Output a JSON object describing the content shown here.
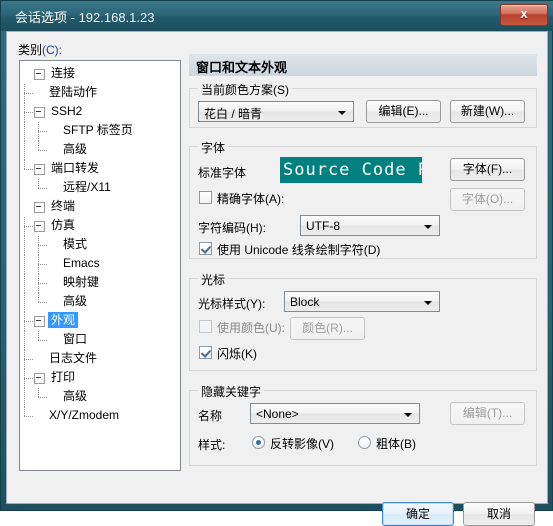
{
  "window": {
    "title_main": "会话选项",
    "title_sep": " - ",
    "title_host": "192.168.1.23",
    "close_icon": "close-icon",
    "close_glyph": "x"
  },
  "tree": {
    "label": "类别(C):",
    "label_text": "类别",
    "label_accel": "(C):",
    "selected": "外观",
    "nodes": [
      {
        "label": "连接",
        "depth": 0,
        "expandable": true,
        "selected": false
      },
      {
        "label": "登陆动作",
        "depth": 1,
        "expandable": false,
        "selected": false
      },
      {
        "label": "SSH2",
        "depth": 1,
        "expandable": true,
        "selected": false
      },
      {
        "label": "SFTP 标签页",
        "depth": 2,
        "expandable": false,
        "selected": false
      },
      {
        "label": "高级",
        "depth": 2,
        "expandable": false,
        "selected": false
      },
      {
        "label": "端口转发",
        "depth": 1,
        "expandable": true,
        "selected": false
      },
      {
        "label": "远程/X11",
        "depth": 2,
        "expandable": false,
        "selected": false
      },
      {
        "label": "终端",
        "depth": 0,
        "expandable": true,
        "selected": false
      },
      {
        "label": "仿真",
        "depth": 1,
        "expandable": true,
        "selected": false
      },
      {
        "label": "模式",
        "depth": 2,
        "expandable": false,
        "selected": false
      },
      {
        "label": "Emacs",
        "depth": 2,
        "expandable": false,
        "selected": false
      },
      {
        "label": "映射键",
        "depth": 2,
        "expandable": false,
        "selected": false
      },
      {
        "label": "高级",
        "depth": 2,
        "expandable": false,
        "selected": false
      },
      {
        "label": "外观",
        "depth": 1,
        "expandable": true,
        "selected": true
      },
      {
        "label": "窗口",
        "depth": 2,
        "expandable": false,
        "selected": false
      },
      {
        "label": "日志文件",
        "depth": 1,
        "expandable": false,
        "selected": false
      },
      {
        "label": "打印",
        "depth": 1,
        "expandable": true,
        "selected": false
      },
      {
        "label": "高级",
        "depth": 2,
        "expandable": false,
        "selected": false
      },
      {
        "label": "X/Y/Zmodem",
        "depth": 1,
        "expandable": false,
        "selected": false
      }
    ]
  },
  "pane": {
    "header": "窗口和文本外观",
    "color_scheme": {
      "group_title": "当前颜色方案(S)",
      "value": "花白 / 暗青",
      "edit_button": "编辑(E)...",
      "new_button": "新建(W)..."
    },
    "font": {
      "group_title": "字体",
      "standard_label": "标准字体",
      "preview_text": "Source Code P",
      "preview_bg": "#00807f",
      "preview_fg": "#ffffff",
      "font_button": "字体(F)...",
      "exact_font_label": "精确字体(A):",
      "exact_font_checked": false,
      "exact_font_button": "字体(O)...",
      "encoding_label": "字符编码(H):",
      "encoding_value": "UTF-8",
      "unicode_line_label": "使用 Unicode 线条绘制字符(D)",
      "unicode_line_checked": true
    },
    "cursor": {
      "group_title": "光标",
      "style_label": "光标样式(Y):",
      "style_value": "Block",
      "use_color_label": "使用颜色(U):",
      "use_color_checked": false,
      "color_button": "颜色(R)...",
      "blink_label": "闪烁(K)",
      "blink_checked": true
    },
    "keyword": {
      "group_title": "隐藏关键字",
      "name_label": "名称",
      "name_value": "<None>",
      "edit_button": "编辑(T)...",
      "style_label": "样式:",
      "option_reverse": "反转影像(V)",
      "option_bold": "粗体(B)",
      "selected_style": "反转影像(V)"
    }
  },
  "footer": {
    "ok_button": "确定",
    "cancel_button": "取消"
  },
  "colors": {
    "titlebar": "#2a6577",
    "close_red": "#b8412c",
    "selection_blue": "#3399ff",
    "accent_teal": "#00807f",
    "client_bg": "#f0f0f0"
  }
}
